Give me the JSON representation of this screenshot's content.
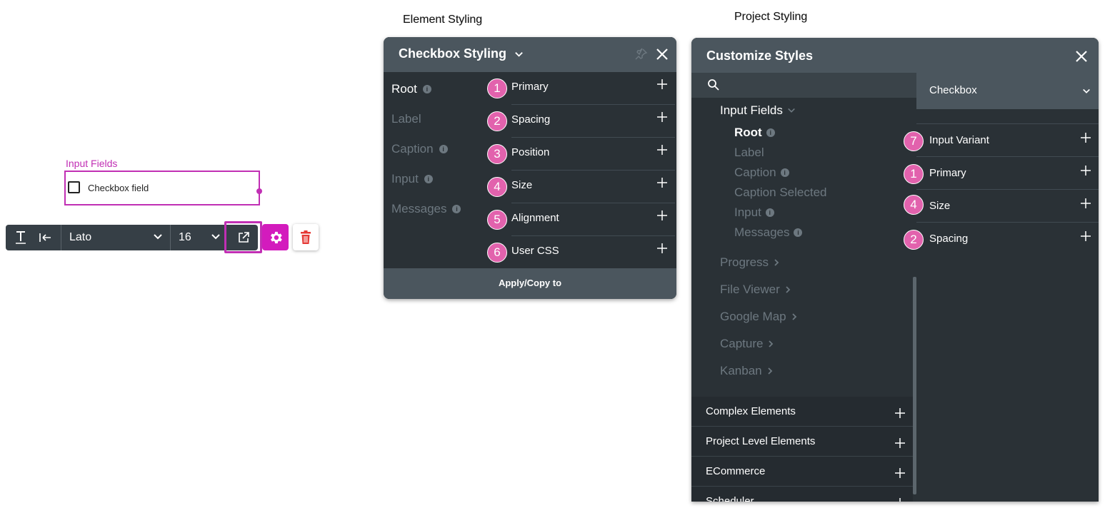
{
  "canvas": {
    "section_label": "Input Fields",
    "checkbox_label": "Checkbox field"
  },
  "toolbar": {
    "font_name": "Lato",
    "font_size": "16",
    "icons": [
      "text-icon",
      "align-left-icon",
      "external-link-icon",
      "gear-icon",
      "trash-icon"
    ]
  },
  "captions": {
    "element": "Element Styling",
    "project": "Project Styling"
  },
  "element_panel": {
    "title": "Checkbox Styling",
    "parts": [
      {
        "label": "Root",
        "info": true
      },
      {
        "label": "Label",
        "info": false
      },
      {
        "label": "Caption",
        "info": true
      },
      {
        "label": "Input",
        "info": true
      },
      {
        "label": "Messages",
        "info": true
      }
    ],
    "sections": [
      {
        "num": "1",
        "label": "Primary"
      },
      {
        "num": "2",
        "label": "Spacing"
      },
      {
        "num": "3",
        "label": "Position"
      },
      {
        "num": "4",
        "label": "Size"
      },
      {
        "num": "5",
        "label": "Alignment"
      },
      {
        "num": "6",
        "label": "User CSS"
      }
    ],
    "footer": "Apply/Copy to"
  },
  "project_panel": {
    "title": "Customize Styles",
    "group": "Input Fields",
    "parts": [
      {
        "label": "Root",
        "info": true
      },
      {
        "label": "Label",
        "info": false
      },
      {
        "label": "Caption",
        "info": true
      },
      {
        "label": "Caption Selected",
        "info": false
      },
      {
        "label": "Input",
        "info": true
      },
      {
        "label": "Messages",
        "info": true
      }
    ],
    "other_groups": [
      "Progress",
      "File Viewer",
      "Google Map",
      "Capture",
      "Kanban"
    ],
    "categories": [
      "Complex Elements",
      "Project Level Elements",
      "ECommerce",
      "Scheduler"
    ],
    "selected_element": "Checkbox",
    "sections": [
      {
        "num": "7",
        "label": "Input Variant"
      },
      {
        "num": "1",
        "label": "Primary"
      },
      {
        "num": "4",
        "label": "Size"
      },
      {
        "num": "2",
        "label": "Spacing"
      }
    ]
  },
  "colors": {
    "accent": "#c12fb4",
    "badge": "#e262ad",
    "panel_dark": "#2a3136",
    "panel_header": "#4b565e",
    "delete_red": "#e53935"
  }
}
